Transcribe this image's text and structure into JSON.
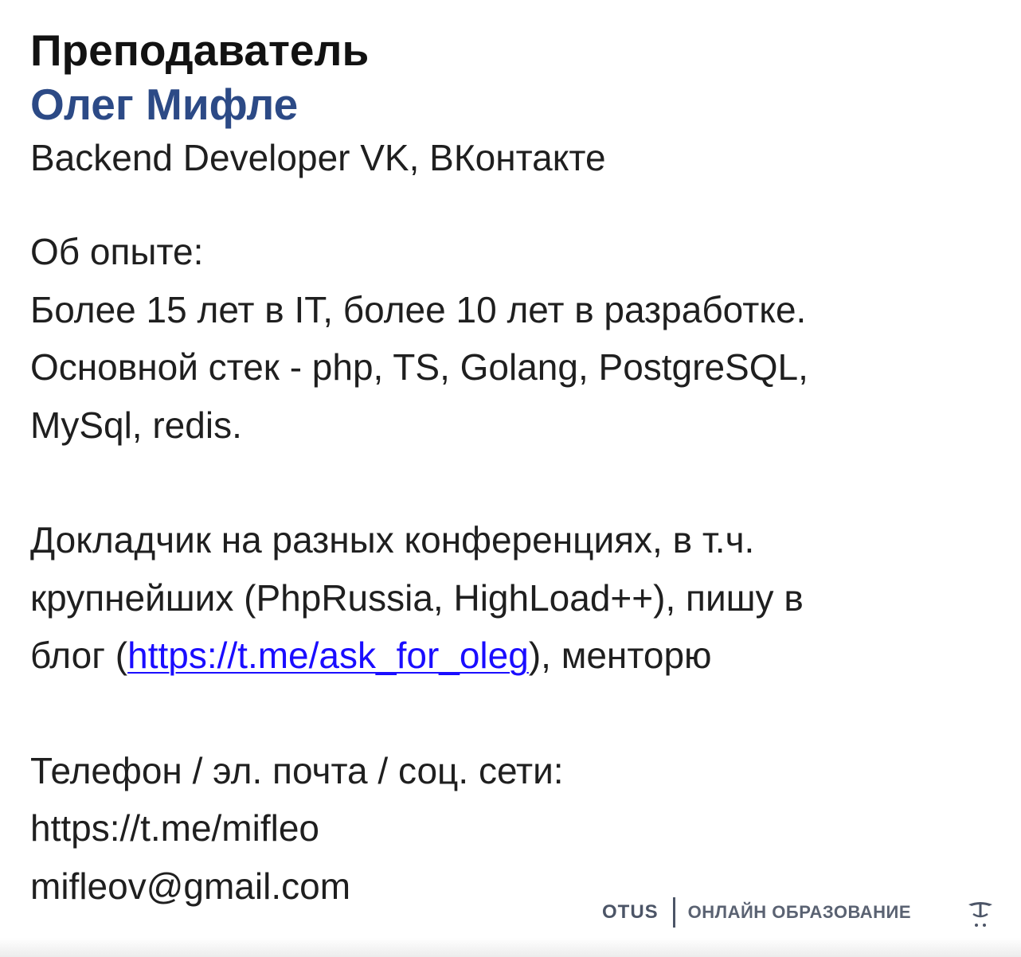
{
  "heading": "Преподаватель",
  "teacher": {
    "name": "Олег Мифле",
    "position": "Backend Developer VK, ВКонтакте"
  },
  "experience": {
    "label": "Об опыте:",
    "line1": "Более 15 лет в IT, более 10 лет в разработке.",
    "line2": "Основной стек - php, TS, Golang, PostgreSQL,",
    "line3": "MySql, redis."
  },
  "speaker": {
    "line1": "Докладчик на разных конференциях, в т.ч.",
    "line2": "крупнейших (PhpRussia, HighLoad++), пишу в",
    "line3_before": "блог (",
    "blog_link": "https://t.me/ask_for_oleg",
    "line3_after": "), менторю"
  },
  "contacts": {
    "label": "Телефон / эл. почта / соц. сети:",
    "telegram": "https://t.me/mifleo",
    "email": "mifleov@gmail.com"
  },
  "footer": {
    "logo": "OTUS",
    "tagline": "ОНЛАЙН ОБРАЗОВАНИЕ"
  },
  "colors": {
    "name_accent": "#2c4a86",
    "link": "#1a0dff",
    "brand_gray": "#4c5567"
  },
  "icons": {
    "brand_mark": "otus-bird-icon"
  }
}
